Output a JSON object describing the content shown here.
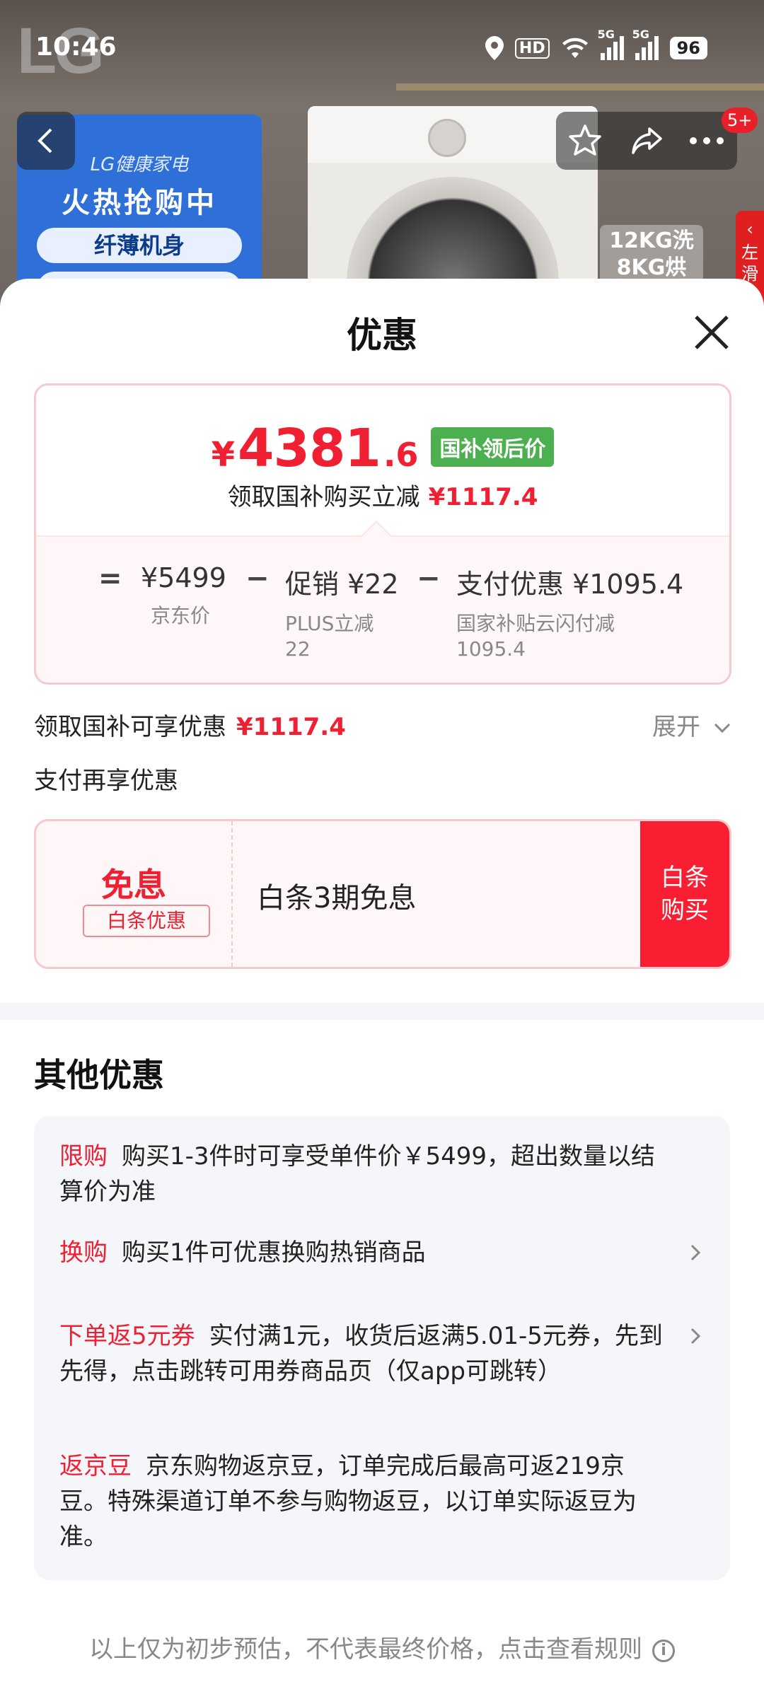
{
  "status_bar": {
    "time": "10:46",
    "hd_label": "HD",
    "network_1": "5G",
    "network_2": "5G",
    "battery": "96"
  },
  "background": {
    "brand_logo": "LG",
    "promo_brand": "LG健康家电",
    "promo_title": "火热抢购中",
    "promo_pill": "纤薄机身",
    "spec_line1": "12KG洗",
    "spec_line2": "8KG烘",
    "side_tab": "左滑",
    "message_badge": "5+"
  },
  "sheet": {
    "title": "优惠",
    "price": {
      "currency": "¥",
      "integer": "4381",
      "decimal": ".6",
      "tag": "国补领后价",
      "subtitle": "领取国补购买立减",
      "subtitle_amount": "¥1117.4"
    },
    "formula": {
      "eq": "=",
      "minus": "−",
      "jd_price_value": "¥5499",
      "jd_price_label": "京东价",
      "promo_value": "促销 ¥22",
      "promo_label_1": "PLUS立减",
      "promo_label_2": "22",
      "pay_value": "支付优惠 ¥1095.4",
      "pay_label_1": "国家补贴云闪付减",
      "pay_label_2": "1095.4"
    },
    "subsidy_row": {
      "label": "领取国补可享优惠",
      "amount": "¥1117.4",
      "expand": "展开"
    },
    "pay_row_label": "支付再享优惠",
    "baitiao": {
      "headline": "免息",
      "chip": "白条优惠",
      "text": "白条3期免息",
      "button": "白条购买"
    },
    "other": {
      "title": "其他优惠",
      "offers": [
        {
          "tag": "限购",
          "text": "购买1-3件时可享受单件价￥5499，超出数量以结算价为准",
          "has_arrow": false
        },
        {
          "tag": "换购",
          "text": "购买1件可优惠换购热销商品",
          "has_arrow": true
        },
        {
          "tag": "下单返5元券",
          "text": "实付满1元，收货后返满5.01-5元券，先到先得，点击跳转可用券商品页（仅app可跳转）",
          "has_arrow": true
        },
        {
          "tag": "返京豆",
          "text": "京东购物返京豆，订单完成后最高可返219京豆。特殊渠道订单不参与购物返豆，以订单实际返豆为准。",
          "has_arrow": false
        }
      ]
    },
    "footer": "以上仅为初步预估，不代表最终价格，点击查看规则",
    "footer_icon": "i"
  },
  "colors": {
    "accent_red": "#f02032",
    "button_red": "#fa1e32",
    "tag_green": "#4caf50"
  },
  "icons": [
    "back-icon",
    "star-icon",
    "share-icon",
    "more-icon",
    "close-icon",
    "chevron-down-icon",
    "chevron-right-icon",
    "info-icon"
  ]
}
